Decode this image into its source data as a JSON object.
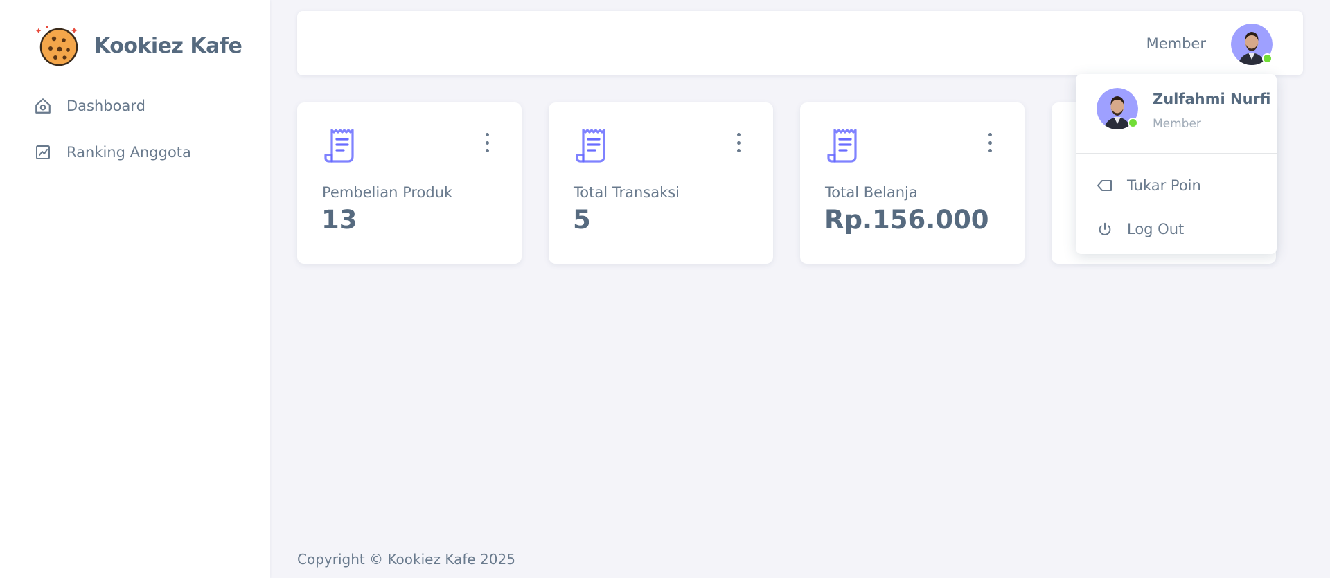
{
  "brand": {
    "name": "Kookiez Kafe"
  },
  "sidebar": {
    "items": [
      {
        "label": "Dashboard",
        "icon": "home-icon"
      },
      {
        "label": "Ranking Anggota",
        "icon": "chart-line-icon"
      }
    ]
  },
  "navbar": {
    "role_label": "Member",
    "online": true
  },
  "cards": [
    {
      "title": "Pembelian Produk",
      "value": "13",
      "icon": "receipt-icon"
    },
    {
      "title": "Total Transaksi",
      "value": "5",
      "icon": "receipt-icon"
    },
    {
      "title": "Total Belanja",
      "value": "Rp.156.000",
      "icon": "receipt-icon"
    }
  ],
  "dropdown": {
    "user_name": "Zulfahmi Nurfi",
    "user_role": "Member",
    "items": [
      {
        "label": "Tukar Poin",
        "icon": "tag-icon"
      },
      {
        "label": "Log Out",
        "icon": "power-icon"
      }
    ]
  },
  "footer": {
    "text": "Copyright © Kookiez Kafe 2025"
  },
  "colors": {
    "accent": "#696cff",
    "text": "#566a7f",
    "muted": "#a1acb8",
    "online": "#71dd37",
    "background": "#f4f4f9"
  }
}
